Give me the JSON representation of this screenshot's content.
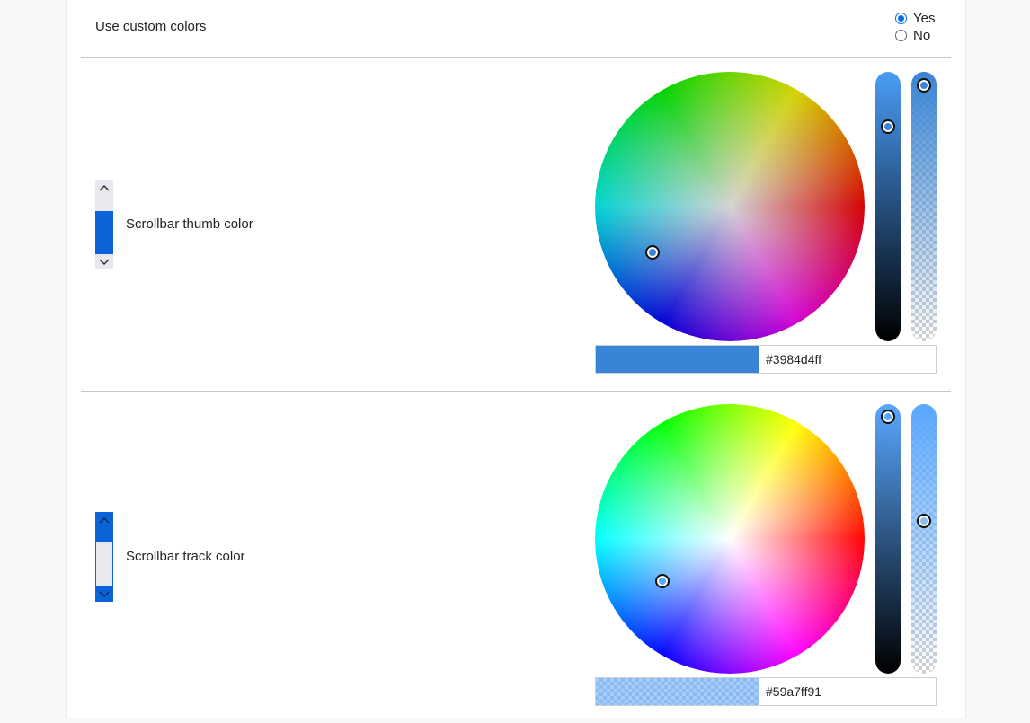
{
  "custom_colors": {
    "label": "Use custom colors",
    "options": [
      {
        "label": "Yes",
        "checked": true
      },
      {
        "label": "No",
        "checked": false
      }
    ]
  },
  "thumb": {
    "label": "Scrollbar thumb color",
    "hex": "#3984d4ff",
    "color": "#3984d4",
    "brightness": 0.83,
    "alpha": 1.0
  },
  "track": {
    "label": "Scrollbar track color",
    "hex": "#59a7ff91",
    "color": "#59a7ff",
    "brightness": 1.0,
    "alpha": 0.57
  },
  "icons": {
    "scroll_up": "▲",
    "scroll_down": "▼"
  },
  "colors": {
    "accent": "#0a6fe0",
    "preview_blue": "#0a64d8",
    "track_gray": "#e8e8ef"
  }
}
